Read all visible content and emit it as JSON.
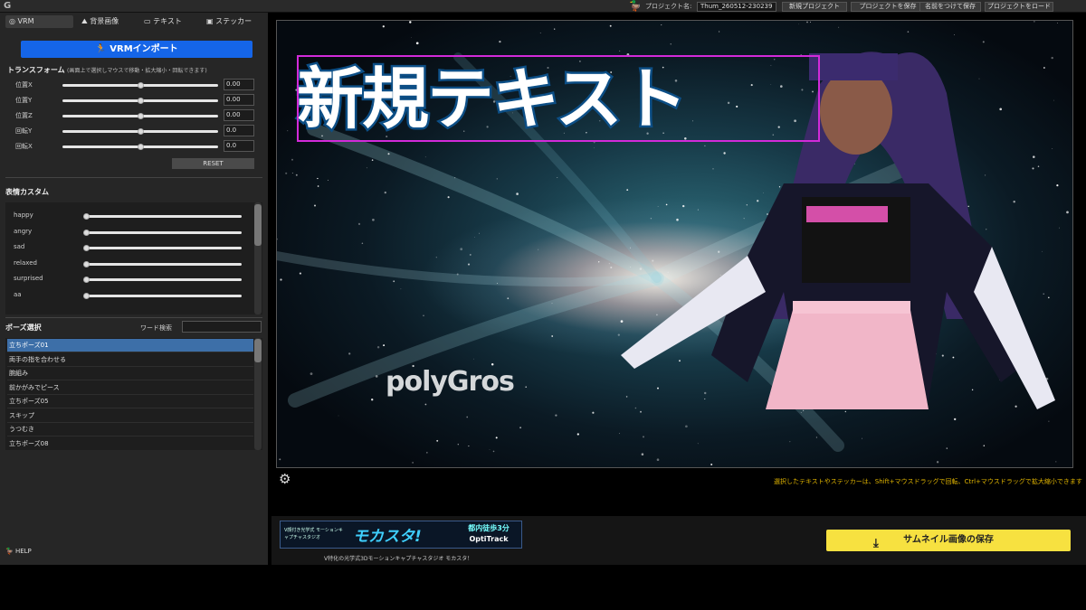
{
  "topbar": {
    "logo": "G",
    "project_name_label": "プロジェクト名:",
    "project_name_value": "Thum_260512-230239",
    "buttons": [
      "新規プロジェクト",
      "プロジェクトを保存",
      "名前をつけて保存",
      "プロジェクトをロード"
    ]
  },
  "tabs": [
    {
      "label": "VRM",
      "icon": "avatar-icon"
    },
    {
      "label": "背景画像",
      "icon": "mountain-icon"
    },
    {
      "label": "テキスト",
      "icon": "chat-icon"
    },
    {
      "label": "ステッカー",
      "icon": "image-icon"
    }
  ],
  "vrm": {
    "import_label": "VRMインポート",
    "transform_title": "トランスフォーム",
    "transform_note": "(画面上で選択しマウスで移動・拡大縮小・回転できます)",
    "transform": [
      {
        "label": "位置X",
        "value": "0.00",
        "level": 0.5
      },
      {
        "label": "位置Y",
        "value": "0.00",
        "level": 0.5
      },
      {
        "label": "位置Z",
        "value": "0.00",
        "level": 0.5
      },
      {
        "label": "回転Y",
        "value": "0.0",
        "level": 0.5
      },
      {
        "label": "回転X",
        "value": "0.0",
        "level": 0.5
      }
    ],
    "reset_label": "RESET"
  },
  "expression": {
    "title": "表情カスタム",
    "items": [
      {
        "label": "happy",
        "level": 0
      },
      {
        "label": "angry",
        "level": 0
      },
      {
        "label": "sad",
        "level": 0
      },
      {
        "label": "relaxed",
        "level": 0
      },
      {
        "label": "surprised",
        "level": 0
      },
      {
        "label": "aa",
        "level": 0
      }
    ]
  },
  "pose": {
    "title": "ポーズ選択",
    "search_label": "ワード検索",
    "search_value": "",
    "items": [
      "立ちポーズ01",
      "両手の指を合わせる",
      "腕組み",
      "前かがみでピース",
      "立ちポーズ05",
      "スキップ",
      "うつむき",
      "立ちポーズ08"
    ],
    "selected_index": 0
  },
  "help_label": "HELP",
  "canvas": {
    "title_text": "新規テキスト",
    "watermark": "polyGros"
  },
  "hint": "選択したテキストやステッカーは、Shift+マウスドラッグで回転、Ctrl+マウスドラッグで拡大縮小できます",
  "banner": {
    "small_text": "V顔付き光学式 モーションキャプチャスタジオ",
    "logo": "モカスタ!",
    "right_line1": "都内徒歩3分",
    "right_line2": "OptiTrack",
    "caption": "V特化の光学式3Dモーションキャプチャスタジオ モカスタ！"
  },
  "save_label": "サムネイル画像の保存",
  "colors": {
    "accent_blue": "#1565e8",
    "save_yellow": "#f7e140",
    "selection_magenta": "#d22ad9",
    "hint_yellow": "#e0b400"
  }
}
